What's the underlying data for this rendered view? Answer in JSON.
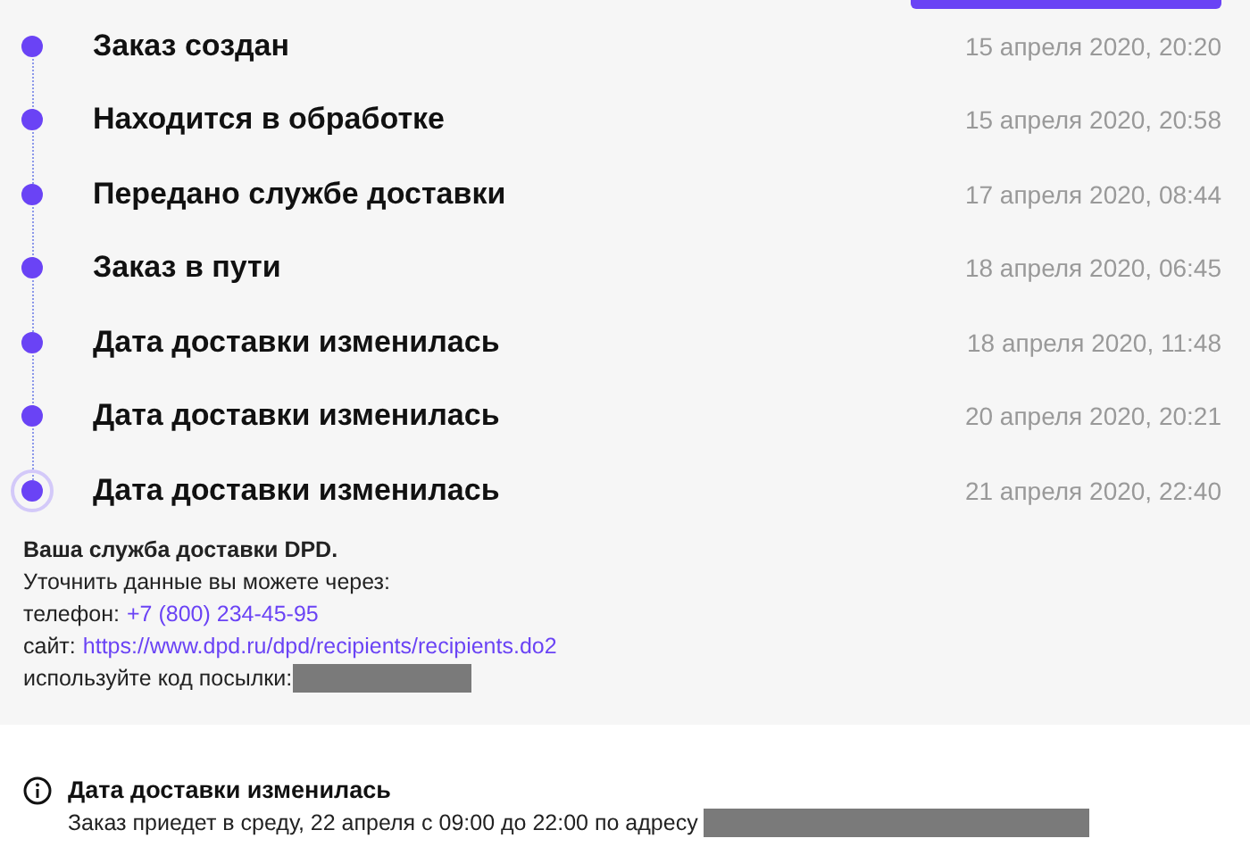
{
  "events": [
    {
      "title": "Заказ создан",
      "date": "15 апреля 2020, 20:20",
      "current": false
    },
    {
      "title": "Находится в обработке",
      "date": "15 апреля 2020, 20:58",
      "current": false
    },
    {
      "title": "Передано службе доставки",
      "date": "17 апреля 2020, 08:44",
      "current": false
    },
    {
      "title": "Заказ в пути",
      "date": "18 апреля 2020, 06:45",
      "current": false
    },
    {
      "title": "Дата доставки изменилась",
      "date": "18 апреля 2020, 11:48",
      "current": false
    },
    {
      "title": "Дата доставки изменилась",
      "date": "20 апреля 2020, 20:21",
      "current": false
    },
    {
      "title": "Дата доставки изменилась",
      "date": "21 апреля 2020, 22:40",
      "current": true
    }
  ],
  "carrier_info": {
    "heading": "Ваша служба доставки DPD.",
    "lines": [
      {
        "kind": "text",
        "text": "Уточнить данные вы можете через:"
      },
      {
        "kind": "link",
        "label": "телефон:",
        "link": "+7 (800) 234-45-95"
      },
      {
        "kind": "link",
        "label": "сайт:",
        "link": "https://www.dpd.ru/dpd/recipients/recipients.do2"
      },
      {
        "kind": "redacted",
        "label": "используйте код посылки:"
      }
    ]
  },
  "notice": {
    "title": "Дата доставки изменилась",
    "text": "Заказ приедет в среду, 22 апреля с 09:00 до 22:00 по адресу"
  }
}
